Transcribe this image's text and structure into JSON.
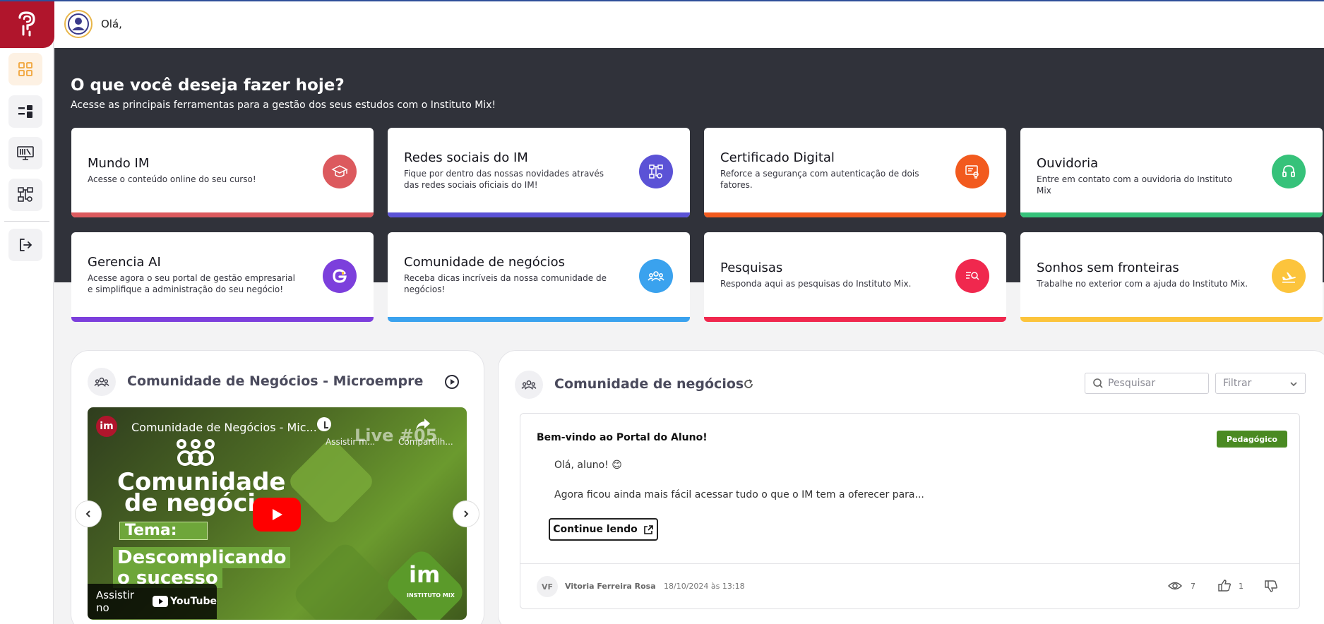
{
  "header": {
    "greeting": "Olá,"
  },
  "hero": {
    "title": "O que você deseja fazer hoje?",
    "subtitle": "Acesse as principais ferramentas para a gestão dos seus estudos com o Instituto Mix!"
  },
  "cards": [
    {
      "title": "Mundo IM",
      "desc": "Acesse o conteúdo online do seu curso!",
      "color": "#dc5a5e",
      "icon": "graduation-cap-icon"
    },
    {
      "title": "Redes sociais do IM",
      "desc": "Fique por dentro das nossas novidades através das redes sociais oficiais do IM!",
      "color": "#5b52d6",
      "icon": "social-network-icon"
    },
    {
      "title": "Certificado Digital",
      "desc": "Reforce a segurança com autenticação de dois fatores.",
      "color": "#f25a1e",
      "icon": "certificate-icon"
    },
    {
      "title": "Ouvidoria",
      "desc": "Entre em contato com a ouvidoria do Instituto Mix",
      "color": "#36c27a",
      "icon": "headset-icon"
    },
    {
      "title": "Gerencia AI",
      "desc": "Acesse agora o seu portal de gestão empresarial e simplifique a administração do seu negócio!",
      "color": "#7c3fdc",
      "icon": "gerencia-ai-icon"
    },
    {
      "title": "Comunidade de negócios",
      "desc": "Receba dicas incríveis da nossa comunidade de negócios!",
      "color": "#3aa2ee",
      "icon": "community-icon"
    },
    {
      "title": "Pesquisas",
      "desc": "Responda aqui as pesquisas do Instituto Mix.",
      "color": "#f0284e",
      "icon": "survey-icon"
    },
    {
      "title": "Sonhos sem fronteiras",
      "desc": "Trabalhe no exterior com a ajuda do Instituto Mix.",
      "color": "#fcc43c",
      "icon": "airplane-icon"
    }
  ],
  "video_panel": {
    "title": "Comunidade de Negócios - Microempreend...",
    "video_title": "Comunidade de Negócios - Mic...",
    "watch_later": "Assistir m...",
    "share": "Compartilh...",
    "live": "Live #05",
    "headline1": "Comunidade",
    "headline2": "de negócios",
    "tema": "Tema:",
    "topic1": "Descomplicando",
    "topic2": "o sucesso",
    "watch_on": "Assistir no",
    "youtube": "YouTube",
    "channel": "im",
    "brand": "INSTITUTO MIX"
  },
  "feed": {
    "title": "Comunidade de negócios",
    "search_placeholder": "Pesquisar",
    "filter_label": "Filtrar",
    "post": {
      "title": "Bem-vindo ao Portal do Aluno!",
      "badge": "Pedagógico",
      "line1": "Olá, aluno! 😊",
      "line2": "Agora ficou ainda mais fácil acessar tudo o que o IM tem a oferecer para...",
      "button": "Continue lendo",
      "author_initials": "VF",
      "author": "Vitoria Ferreira Rosa",
      "date": "18/10/2024 às 13:18",
      "views": "7",
      "likes": "1"
    }
  }
}
